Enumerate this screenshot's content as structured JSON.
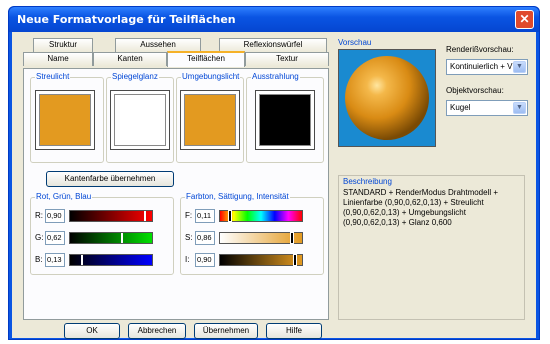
{
  "window": {
    "title": "Neue Formatvorlage für Teilflächen",
    "close_glyph": "✕"
  },
  "tabs": {
    "row1": [
      "Struktur",
      "Aussehen",
      "Reflexionswürfel"
    ],
    "row2": [
      "Name",
      "Kanten",
      "Teilflächen",
      "Textur"
    ],
    "active": "Teilflächen"
  },
  "swatches": [
    {
      "label": "Streulicht",
      "color": "#e39a20"
    },
    {
      "label": "Spiegelglanz",
      "color": "#ffffff"
    },
    {
      "label": "Umgebungslicht",
      "color": "#e39a20"
    },
    {
      "label": "Ausstrahlung",
      "color": "#000000"
    }
  ],
  "edge_color_button": "Kantenfarbe übernehmen",
  "rgb": {
    "title": "Rot, Grün, Blau",
    "rows": [
      {
        "label": "R:",
        "value": "0,90",
        "fraction": 0.9,
        "color": "#ff0000"
      },
      {
        "label": "G:",
        "value": "0,62",
        "fraction": 0.62,
        "color": "#00e000"
      },
      {
        "label": "B:",
        "value": "0,13",
        "fraction": 0.13,
        "color": "#0000ff"
      }
    ]
  },
  "hsi": {
    "title": "Farbton, Sättigung, Intensität",
    "rows": [
      {
        "label": "F:",
        "value": "0,11",
        "fraction": 0.11
      },
      {
        "label": "S:",
        "value": "0,86",
        "fraction": 0.86
      },
      {
        "label": "I:",
        "value": "0,90",
        "fraction": 0.9
      }
    ]
  },
  "preview": {
    "label": "Vorschau"
  },
  "render_preview": {
    "label": "Renderißvorschau:",
    "value": "Kontinuierlich + VH"
  },
  "object_preview": {
    "label": "Objektvorschau:",
    "value": "Kugel"
  },
  "description": {
    "label": "Beschreibung",
    "text": "STANDARD + RenderModus Drahtmodell + Linienfarbe (0,90,0,62,0,13) + Streulicht (0,90,0,62,0,13) + Umgebungslicht (0,90,0,62,0,13) + Glanz 0,600"
  },
  "buttons": {
    "ok": "OK",
    "cancel": "Abbrechen",
    "apply": "Übernehmen",
    "help": "Hilfe"
  }
}
